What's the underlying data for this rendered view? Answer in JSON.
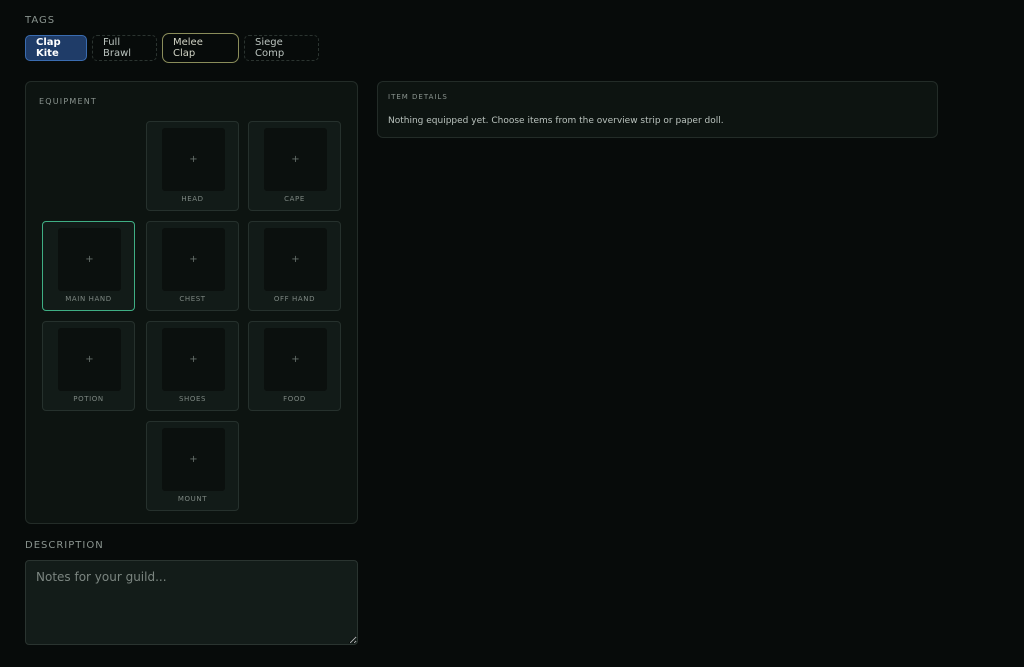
{
  "tags": {
    "label": "TAGS",
    "items": [
      {
        "label": "Clap Kite",
        "state": "active"
      },
      {
        "label": "Full Brawl",
        "state": "default"
      },
      {
        "label": "Melee Clap",
        "state": "outlined"
      },
      {
        "label": "Siege Comp",
        "state": "default"
      }
    ]
  },
  "equipment": {
    "title": "EQUIPMENT",
    "slots": {
      "head": {
        "label": "HEAD",
        "icon": "+"
      },
      "cape": {
        "label": "CAPE",
        "icon": "+"
      },
      "main_hand": {
        "label": "MAIN HAND",
        "icon": "+"
      },
      "chest": {
        "label": "CHEST",
        "icon": "+"
      },
      "off_hand": {
        "label": "OFF HAND",
        "icon": "+"
      },
      "potion": {
        "label": "POTION",
        "icon": "+"
      },
      "shoes": {
        "label": "SHOES",
        "icon": "+"
      },
      "food": {
        "label": "FOOD",
        "icon": "+"
      },
      "mount": {
        "label": "MOUNT",
        "icon": "+"
      }
    }
  },
  "item_details": {
    "title": "ITEM DETAILS",
    "message": "Nothing equipped yet. Choose items from the overview strip or paper doll."
  },
  "description": {
    "label": "DESCRIPTION",
    "placeholder": "Notes for your guild..."
  },
  "colors": {
    "background": "#070b0a",
    "active_tag": "#1f3c68",
    "selected_slot_border": "#3fae84",
    "outlined_tag_border": "#8a8d5a"
  }
}
